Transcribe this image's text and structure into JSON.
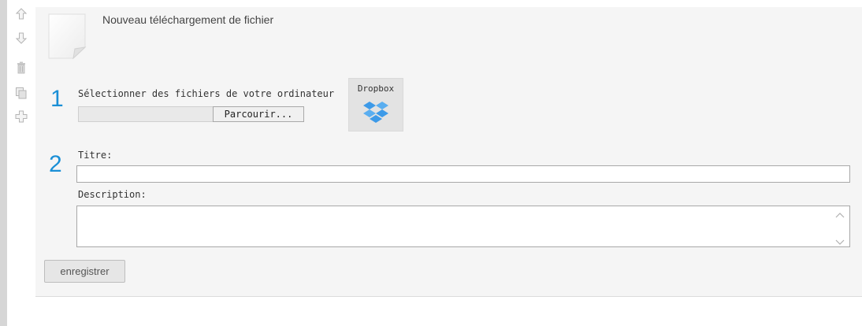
{
  "header": {
    "title": "Nouveau téléchargement de fichier"
  },
  "sidebar": {
    "icons": [
      "arrow-up-icon",
      "arrow-down-icon",
      "trash-icon",
      "copy-icon",
      "plus-icon"
    ]
  },
  "step1": {
    "number": "1",
    "label": "Sélectionner des fichiers de votre ordinateur",
    "file_value": "",
    "browse_label": "Parcourir...",
    "dropbox_label": "Dropbox"
  },
  "step2": {
    "number": "2",
    "title_label": "Titre:",
    "title_value": "",
    "description_label": "Description:",
    "description_value": ""
  },
  "actions": {
    "save_label": "enregistrer"
  },
  "colors": {
    "step_number": "#1a8fd6",
    "panel_bg": "#f5f5f5",
    "dropbox_blue": "#3d9ae8"
  }
}
